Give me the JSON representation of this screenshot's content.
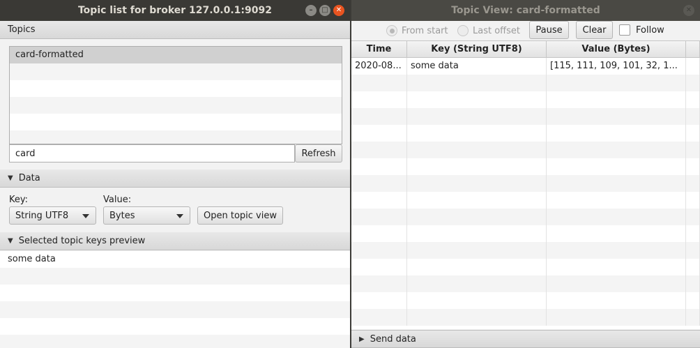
{
  "left_window": {
    "title": "Topic list for broker 127.0.0.1:9092",
    "topics_header": "Topics",
    "topics": [
      "card-formatted",
      "",
      "",
      "",
      "",
      ""
    ],
    "filter_value": "card",
    "refresh_label": "Refresh",
    "data_header": "Data",
    "key_label": "Key:",
    "key_value": "String UTF8",
    "value_label": "Value:",
    "value_value": "Bytes",
    "open_topic_view_label": "Open topic view",
    "preview_header": "Selected topic keys preview",
    "preview_items": [
      "some data",
      "",
      "",
      "",
      "",
      ""
    ]
  },
  "right_window": {
    "title": "Topic View: card-formatted",
    "from_start_label": "From start",
    "last_offset_label": "Last offset",
    "pause_label": "Pause",
    "clear_label": "Clear",
    "follow_label": "Follow",
    "columns": [
      "Time",
      "Key (String UTF8)",
      "Value (Bytes)"
    ],
    "rows": [
      [
        "2020-08...",
        "some data",
        "[115, 111, 109, 101, 32, 1..."
      ]
    ],
    "send_header": "Send data"
  }
}
